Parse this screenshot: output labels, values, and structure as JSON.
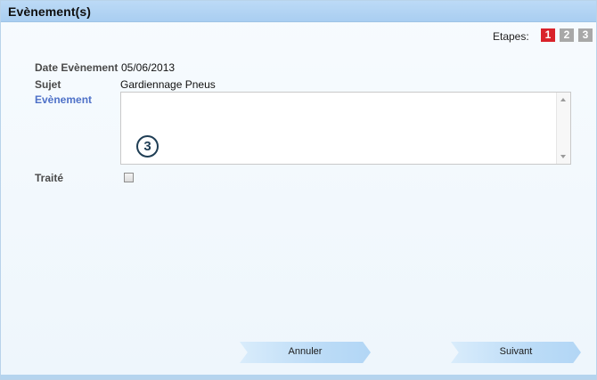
{
  "window": {
    "title": "Evènement(s)"
  },
  "steps": {
    "label": "Etapes:",
    "items": [
      "1",
      "2",
      "3"
    ],
    "active": "1",
    "active_color": "#d9222a",
    "inactive_color": "#a8a8a8"
  },
  "form": {
    "date_label": "Date Evènement",
    "date_value": "05/06/2013",
    "subject_label": "Sujet",
    "subject_value": "Gardiennage Pneus",
    "event_label": "Evènement",
    "event_value": "",
    "treated_label": "Traité",
    "treated_checked": false
  },
  "annotation": {
    "label": "3"
  },
  "buttons": {
    "cancel_label": "Annuler",
    "next_label": "Suivant"
  }
}
